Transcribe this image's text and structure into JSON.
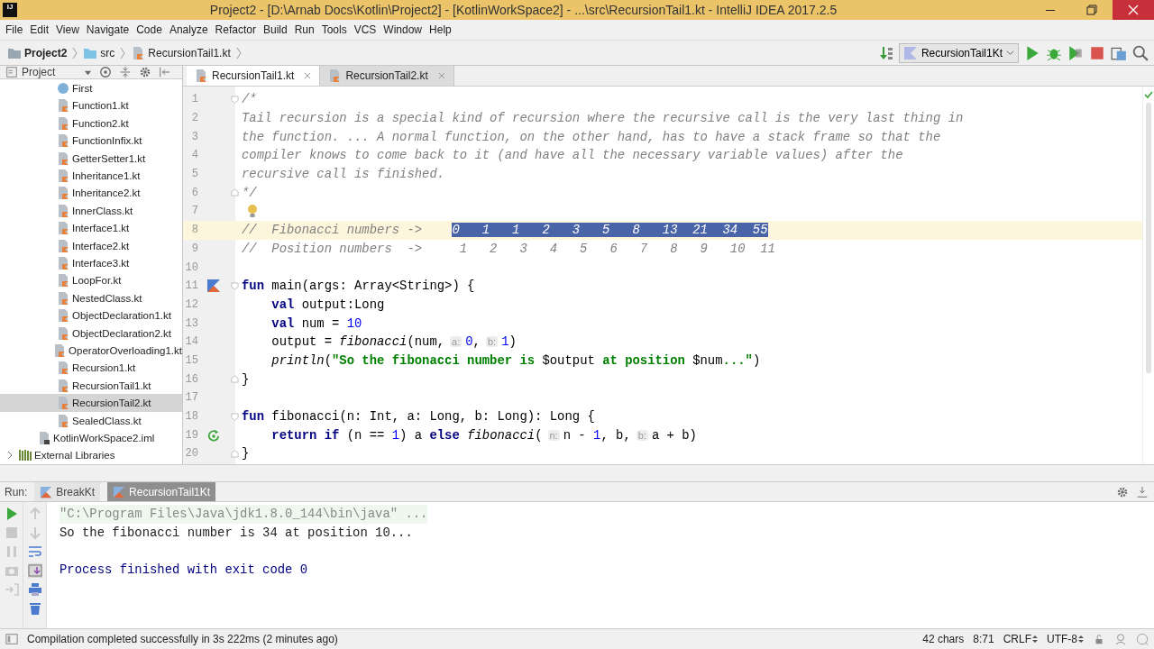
{
  "window": {
    "logo": "IJ",
    "title": "Project2 - [D:\\Arnab Docs\\Kotlin\\Project2] - [KotlinWorkSpace2] - ...\\src\\RecursionTail1.kt - IntelliJ IDEA 2017.2.5"
  },
  "menu": [
    "File",
    "Edit",
    "View",
    "Navigate",
    "Code",
    "Analyze",
    "Refactor",
    "Build",
    "Run",
    "Tools",
    "VCS",
    "Window",
    "Help"
  ],
  "breadcrumb": [
    {
      "label": "Project2",
      "kind": "project"
    },
    {
      "label": "src",
      "kind": "folder"
    },
    {
      "label": "RecursionTail1.kt",
      "kind": "file"
    }
  ],
  "run_config": {
    "label": "RecursionTail1Kt"
  },
  "project_panel": {
    "title": "Project"
  },
  "project_tree": [
    {
      "children": [
        {
          "children": [
            {
              "label": "First",
              "kind": "class",
              "selected": false
            },
            {
              "label": "Function1.kt",
              "kind": "file",
              "selected": false
            },
            {
              "label": "Function2.kt",
              "kind": "file",
              "selected": false
            },
            {
              "label": "FunctionInfix.kt",
              "kind": "file",
              "selected": false
            },
            {
              "label": "GetterSetter1.kt",
              "kind": "file",
              "selected": false
            },
            {
              "label": "Inheritance1.kt",
              "kind": "file",
              "selected": false
            },
            {
              "label": "Inheritance2.kt",
              "kind": "file",
              "selected": false
            },
            {
              "label": "InnerClass.kt",
              "kind": "file",
              "selected": false
            },
            {
              "label": "Interface1.kt",
              "kind": "file",
              "selected": false
            },
            {
              "label": "Interface2.kt",
              "kind": "file",
              "selected": false
            },
            {
              "label": "Interface3.kt",
              "kind": "file",
              "selected": false
            },
            {
              "label": "LoopFor.kt",
              "kind": "file",
              "selected": false
            },
            {
              "label": "NestedClass.kt",
              "kind": "file",
              "selected": false
            },
            {
              "label": "ObjectDeclaration1.kt",
              "kind": "file",
              "selected": false
            },
            {
              "label": "ObjectDeclaration2.kt",
              "kind": "file",
              "selected": false
            },
            {
              "label": "OperatorOverloading1.kt",
              "kind": "file",
              "selected": false
            },
            {
              "label": "Recursion1.kt",
              "kind": "file",
              "selected": false
            },
            {
              "label": "RecursionTail1.kt",
              "kind": "file",
              "selected": false
            },
            {
              "label": "RecursionTail2.kt",
              "kind": "file",
              "selected": true
            },
            {
              "label": "SealedClass.kt",
              "kind": "file",
              "selected": false
            }
          ]
        },
        {
          "label": "KotlinWorkSpace2.iml",
          "kind": "iml",
          "selected": false
        }
      ]
    },
    {
      "label": "External Libraries",
      "kind": "library",
      "selected": false,
      "expanded": false
    }
  ],
  "editor_tabs": [
    {
      "label": "RecursionTail1.kt",
      "selected": true
    },
    {
      "label": "RecursionTail2.kt",
      "selected": false
    }
  ],
  "code_lines": [
    {
      "number": "1",
      "fold": {
        "kind": "start"
      },
      "tokens": [
        {
          "text": "/*",
          "kind": "comment"
        }
      ]
    },
    {
      "number": "2",
      "tokens": [
        {
          "text": "Tail recursion is a special kind of recursion where the recursive call is the very last thing in",
          "kind": "comment"
        }
      ]
    },
    {
      "number": "3",
      "tokens": [
        {
          "text": "the function. ... A normal function, on the other hand, has to have a stack frame so that the",
          "kind": "comment"
        }
      ]
    },
    {
      "number": "4",
      "tokens": [
        {
          "text": "compiler knows to come back to it (and have all the necessary variable values) after the",
          "kind": "comment"
        }
      ]
    },
    {
      "number": "5",
      "tokens": [
        {
          "text": "recursive call is finished.",
          "kind": "comment"
        }
      ]
    },
    {
      "number": "6",
      "fold": {
        "kind": "end"
      },
      "tokens": [
        {
          "text": "*/",
          "kind": "comment"
        }
      ]
    },
    {
      "number": "7",
      "marker": {
        "kind": "bulb"
      }
    },
    {
      "number": "8",
      "current": true,
      "tokens": [
        {
          "text": "//  Fibonacci numbers ->",
          "kind": "comment"
        },
        {
          "text": "0   1   1   2   3   5   8   13  21  34  55",
          "kind": "selection"
        }
      ]
    },
    {
      "number": "9",
      "tokens": [
        {
          "text": "//  Position numbers  ->     1   2   3   4   5   6   7   8   9   10  11",
          "kind": "comment"
        }
      ]
    },
    {
      "number": "10"
    },
    {
      "number": "11",
      "gutter": {
        "kind": "run"
      },
      "fold": {
        "kind": "start"
      },
      "tokens": [
        {
          "text": "fun",
          "kind": "keyword"
        },
        {
          "text": "main(args: Array<String>) {",
          "kind": "plain"
        }
      ]
    },
    {
      "number": "12",
      "indented": true,
      "tokens": [
        {
          "text": "val",
          "kind": "keyword"
        },
        {
          "text": "output:Long",
          "kind": "plain"
        }
      ]
    },
    {
      "number": "13",
      "indented": true,
      "tokens": [
        {
          "text": "val",
          "kind": "keyword"
        },
        {
          "text": "num =",
          "kind": "plain"
        },
        {
          "text": "10",
          "kind": "number"
        }
      ]
    },
    {
      "number": "14",
      "indented": true,
      "tokens": [
        {
          "text": "output =",
          "kind": "plain"
        },
        {
          "text": "fibonacci",
          "kind": "call"
        },
        {
          "text": "(num,",
          "kind": "plain"
        },
        {
          "text": "a:",
          "kind": "hint"
        },
        {
          "text": "0",
          "kind": "number"
        },
        {
          "text": ",",
          "kind": "plain"
        },
        {
          "text": "b:",
          "kind": "hint"
        },
        {
          "text": "1",
          "kind": "number"
        },
        {
          "text": ")",
          "kind": "plain"
        }
      ]
    },
    {
      "number": "15",
      "indented": true,
      "tokens": [
        {
          "text": "println",
          "kind": "call"
        },
        {
          "text": "(",
          "kind": "plain"
        },
        {
          "text": "\"So the fibonacci number is",
          "kind": "string"
        },
        {
          "text": "$output",
          "kind": "plain"
        },
        {
          "text": "at position",
          "kind": "string"
        },
        {
          "text": "$num",
          "kind": "plain"
        },
        {
          "text": "...\"",
          "kind": "string"
        },
        {
          "text": ")",
          "kind": "plain"
        }
      ]
    },
    {
      "number": "16",
      "fold": {
        "kind": "end"
      },
      "tokens": [
        {
          "text": "}",
          "kind": "plain"
        }
      ]
    },
    {
      "number": "17"
    },
    {
      "number": "18",
      "fold": {
        "kind": "start"
      },
      "tokens": [
        {
          "text": "fun",
          "kind": "keyword"
        },
        {
          "text": "fibonacci(n: Int, a: Long, b: Long): Long {",
          "kind": "plain"
        }
      ]
    },
    {
      "number": "19",
      "indented": true,
      "gutter": {
        "kind": "recursion"
      },
      "tokens": [
        {
          "text": "return if",
          "kind": "keyword"
        },
        {
          "text": "(n ==",
          "kind": "plain"
        },
        {
          "text": "1",
          "kind": "number"
        },
        {
          "text": ") a",
          "kind": "plain"
        },
        {
          "text": "else",
          "kind": "keyword"
        },
        {
          "text": "fibonacci",
          "kind": "call"
        },
        {
          "text": "(",
          "kind": "plain"
        },
        {
          "text": "n:",
          "kind": "hint"
        },
        {
          "text": "n -",
          "kind": "plain"
        },
        {
          "text": "1",
          "kind": "number"
        },
        {
          "text": ", b,",
          "kind": "plain"
        },
        {
          "text": "b:",
          "kind": "hint"
        },
        {
          "text": "a + b)",
          "kind": "plain"
        }
      ]
    },
    {
      "number": "20",
      "fold": {
        "kind": "end"
      },
      "tokens": [
        {
          "text": "}",
          "kind": "plain"
        }
      ]
    }
  ],
  "run_panel": {
    "label": "Run:",
    "tabs": [
      {
        "label": "BreakKt",
        "selected": false
      },
      {
        "label": "RecursionTail1Kt",
        "selected": true
      }
    ],
    "console": [
      {
        "text": "\"C:\\Program Files\\Java\\jdk1.8.0_144\\bin\\java\" ...",
        "kind": "command"
      },
      {
        "text": "So the fibonacci number is 34 at position 10...",
        "kind": "output"
      },
      {
        "text": "Process finished with exit code 0",
        "kind": "exit"
      }
    ]
  },
  "status_bar": {
    "message": "Compilation completed successfully in 3s 222ms (2 minutes ago)",
    "chars": "42 chars",
    "position": "8:71",
    "line_separator": "CRLF",
    "encoding": "UTF-8"
  }
}
